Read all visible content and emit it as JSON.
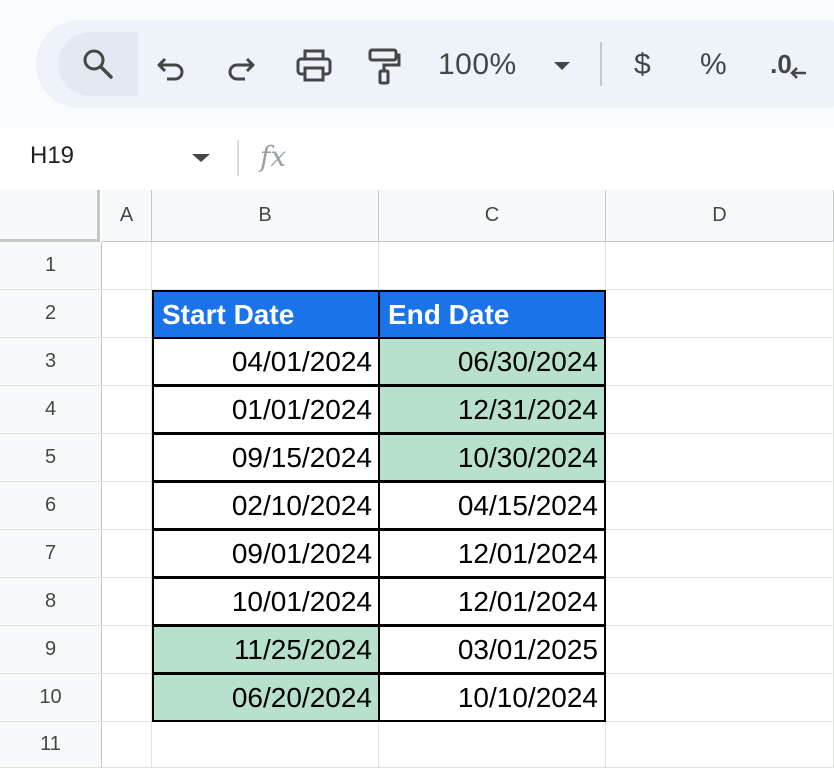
{
  "toolbar": {
    "zoom": "100%",
    "currency_label": "$",
    "percent_label": "%",
    "decimal_label": ".0"
  },
  "formula_bar": {
    "namebox": "H19",
    "fx_label": "fx"
  },
  "columns": [
    "A",
    "B",
    "C",
    "D"
  ],
  "rows": [
    "1",
    "2",
    "3",
    "4",
    "5",
    "6",
    "7",
    "8",
    "9",
    "10",
    "11"
  ],
  "table": {
    "headers": [
      "Start Date",
      "End Date"
    ],
    "start_dates": [
      "04/01/2024",
      "01/01/2024",
      "09/15/2024",
      "02/10/2024",
      "09/01/2024",
      "10/01/2024",
      "11/25/2024",
      "06/20/2024"
    ],
    "end_dates": [
      "06/30/2024",
      "12/31/2024",
      "10/30/2024",
      "04/15/2024",
      "12/01/2024",
      "12/01/2024",
      "03/01/2025",
      "10/10/2024"
    ],
    "start_highlighted": [
      false,
      false,
      false,
      false,
      false,
      false,
      true,
      true
    ],
    "end_highlighted": [
      true,
      true,
      true,
      false,
      false,
      false,
      false,
      false
    ]
  },
  "colors": {
    "header_fill": "#1a73e8",
    "highlight_fill": "#b7e1cd"
  }
}
